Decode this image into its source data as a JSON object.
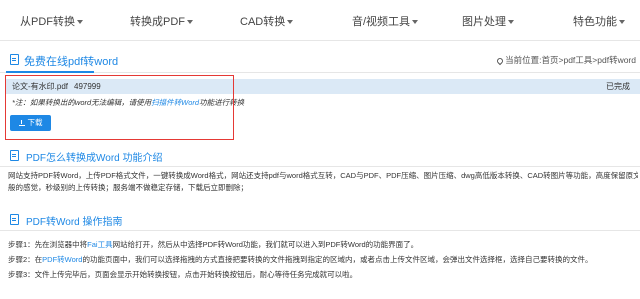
{
  "nav": {
    "items": [
      {
        "label": "从PDF转换"
      },
      {
        "label": "转换成PDF"
      },
      {
        "label": "CAD转换"
      },
      {
        "label": "音/视频工具"
      },
      {
        "label": "图片处理"
      },
      {
        "label": "特色功能"
      }
    ]
  },
  "tool": {
    "title": "免费在线pdf转word",
    "breadcrumb": "当前位置:首页>pdf工具>pdf转word"
  },
  "file": {
    "name": "论文-有水印.pdf",
    "size": "497999",
    "status": "已完成",
    "note_pre": "*注：如果转换出的word无法编辑，请使用",
    "note_link": "扫描件转Word",
    "note_post": "功能进行转换",
    "download_label": "下载"
  },
  "intro": {
    "title": "PDF怎么转换成Word 功能介绍",
    "line1": "网站支持PDF转Word，上传PDF格式文件，一键转换成Word格式，网站还支持pdf与word格式互转，CAD与PDF、PDF压缩、图片压缩、dwg高低版本转换、CAD转图片等功能，高度保留原文档布局及格式，飞一",
    "line2": "般的感觉，秒级别的上传转换；服务端不做稳定存储，下载后立即删除；"
  },
  "guide": {
    "title": "PDF转Word 操作指南",
    "step1_pre": "步骤1：先在浏览器中将",
    "step1_link": "Fai工具",
    "step1_post": "网站给打开，然后从中选择PDF转Word功能，我们就可以进入到PDF转Word的功能界面了。",
    "step2_pre": "步骤2：在",
    "step2_link": "PDF转Word",
    "step2_post": "的功能页面中，我们可以选择拖拽的方式直接把要转换的文件拖拽到指定的区域内，或者点击上传文件区域，会弹出文件选择框，选择自己要转换的文件。",
    "step3": "步骤3：文件上传完毕后，页面会显示开始转换按钮，点击开始转换按钮后，耐心等待任务完成就可以啦。"
  }
}
